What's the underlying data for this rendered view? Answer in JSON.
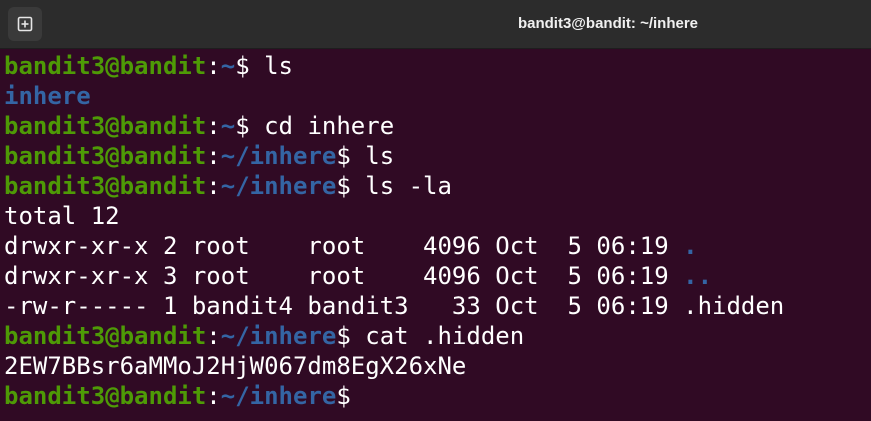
{
  "window": {
    "title": "bandit3@bandit: ~/inhere",
    "new_tab_icon": "new-tab-icon"
  },
  "colors": {
    "background": "#300a24",
    "prompt_user": "#4e9a06",
    "prompt_path": "#3465a4",
    "text": "#ffffff"
  },
  "terminal": {
    "lines": [
      {
        "user": "bandit3@bandit",
        "sep": ":",
        "path": "~",
        "sym": "$ ",
        "cmd": "ls"
      },
      {
        "dir": "inhere"
      },
      {
        "user": "bandit3@bandit",
        "sep": ":",
        "path": "~",
        "sym": "$ ",
        "cmd": "cd inhere"
      },
      {
        "user": "bandit3@bandit",
        "sep": ":",
        "path": "~/inhere",
        "sym": "$ ",
        "cmd": "ls"
      },
      {
        "user": "bandit3@bandit",
        "sep": ":",
        "path": "~/inhere",
        "sym": "$ ",
        "cmd": "ls -la"
      },
      {
        "text": "total 12"
      },
      {
        "text": "drwxr-xr-x 2 root    root    4096 Oct  5 06:19 ",
        "dir": "."
      },
      {
        "text": "drwxr-xr-x 3 root    root    4096 Oct  5 06:19 ",
        "dir": ".."
      },
      {
        "text": "-rw-r----- 1 bandit4 bandit3   33 Oct  5 06:19 .hidden"
      },
      {
        "user": "bandit3@bandit",
        "sep": ":",
        "path": "~/inhere",
        "sym": "$ ",
        "cmd": "cat .hidden"
      },
      {
        "text": "2EW7BBsr6aMMoJ2HjW067dm8EgX26xNe"
      },
      {
        "user": "bandit3@bandit",
        "sep": ":",
        "path": "~/inhere",
        "sym": "$",
        "cmd": ""
      }
    ]
  }
}
